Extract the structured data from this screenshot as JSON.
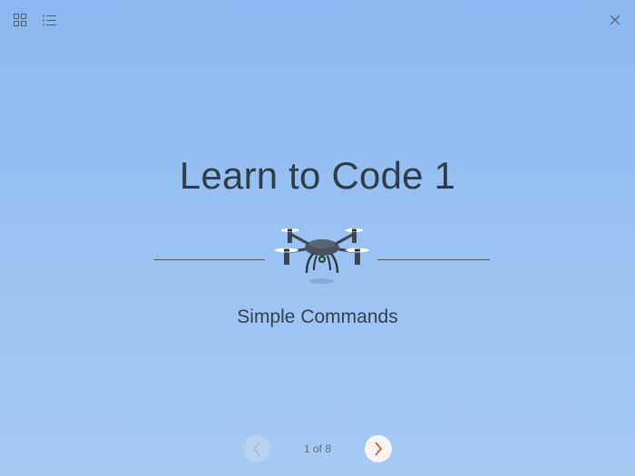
{
  "toolbar": {
    "grid_icon": "grid-icon",
    "list_icon": "list-icon",
    "close_icon": "close-icon"
  },
  "main": {
    "title": "Learn to Code 1",
    "subtitle": "Simple Commands",
    "illustration": "drone-icon"
  },
  "pager": {
    "prev_icon": "chevron-left-icon",
    "next_icon": "chevron-right-icon",
    "indicator": "1 of 8",
    "current_page": 1,
    "total_pages": 8
  },
  "colors": {
    "background_top": "#8bb8f0",
    "background_bottom": "#a6caf4",
    "title_text": "#2e3d4a",
    "next_chevron": "#d9452b"
  }
}
